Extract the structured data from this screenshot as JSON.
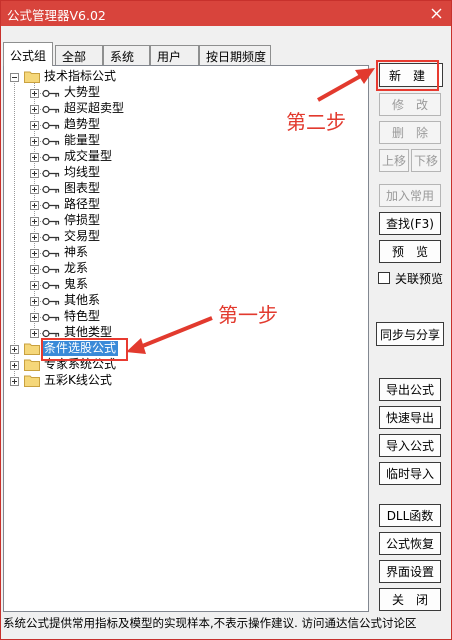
{
  "window": {
    "title": "公式管理器V6.02"
  },
  "tabs": [
    {
      "label": "公式组",
      "active": true
    },
    {
      "label": "全部"
    },
    {
      "label": "系统"
    },
    {
      "label": "用户"
    },
    {
      "label": "按日期频度"
    }
  ],
  "tree": {
    "root_open": "技术指标公式",
    "children": [
      "大势型",
      "超买超卖型",
      "趋势型",
      "能量型",
      "成交量型",
      "均线型",
      "图表型",
      "路径型",
      "停损型",
      "交易型",
      "神系",
      "龙系",
      "鬼系",
      "其他系",
      "特色型",
      "其他类型"
    ],
    "collapsed": [
      "条件选股公式",
      "专家系统公式",
      "五彩K线公式"
    ],
    "selected": "条件选股公式"
  },
  "buttons": {
    "new": "新　建",
    "modify": "修　改",
    "delete": "删　除",
    "move_up": "上移",
    "move_down": "下移",
    "add_common": "加入常用",
    "find": "查找(F3)",
    "preview": "预　览",
    "link_preview": "关联预览",
    "sync_share": "同步与分享",
    "export": "导出公式",
    "quick_export": "快速导出",
    "import": "导入公式",
    "temp_import": "临时导入",
    "dll": "DLL函数",
    "restore": "公式恢复",
    "ui_settings": "界面设置",
    "close": "关　闭"
  },
  "status_text": "系统公式提供常用指标及模型的实现样本,不表示操作建议.   访问通达信公式讨论区",
  "annotations": {
    "step1": "第一步",
    "step2": "第二步"
  },
  "colors": {
    "titlebar": "#d8443c",
    "annotation": "#e23a2e",
    "selection": "#3a8ad8"
  }
}
